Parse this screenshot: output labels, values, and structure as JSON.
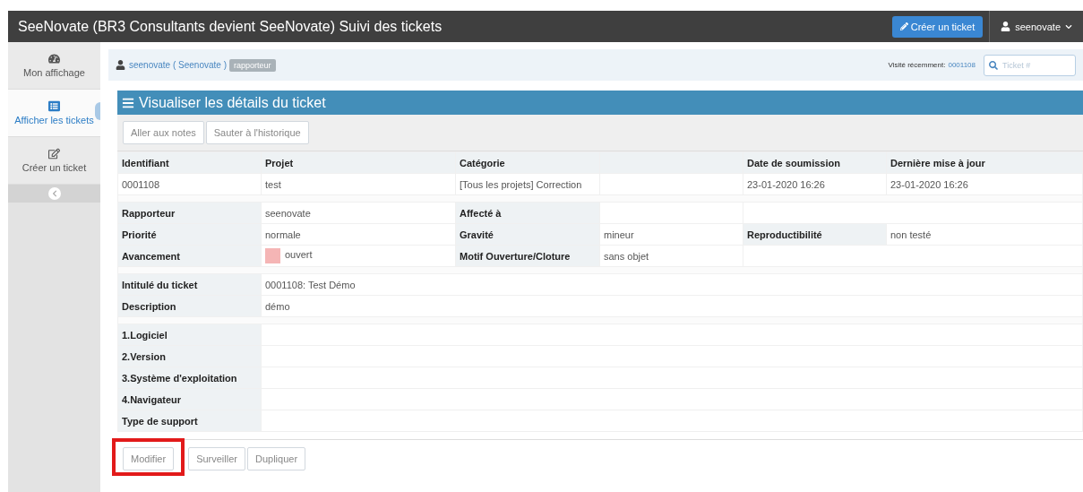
{
  "navbar": {
    "title": "SeeNovate (BR3 Consultants devient SeeNovate) Suivi des tickets",
    "create_button": "Créer un ticket",
    "user_menu": "seenovate"
  },
  "sidebar": {
    "items": [
      {
        "label": "Mon affichage",
        "selected": false
      },
      {
        "label": "Afficher les tickets",
        "selected": true
      },
      {
        "label": "Créer un ticket",
        "selected": false
      }
    ]
  },
  "breadcrumb": {
    "user": "seenovate ( Seenovate )",
    "role": "rapporteur",
    "recent_label": "Visité récemment:",
    "recent_link": "0001108",
    "search": {
      "placeholder": "Ticket #"
    }
  },
  "panel": {
    "title": "Visualiser les détails du ticket",
    "top_buttons": [
      "Aller aux notes",
      "Sauter à l'historique"
    ],
    "summary": [
      {
        "heading": "Identifiant",
        "value": "0001108"
      },
      {
        "heading": "Projet",
        "value": "test"
      },
      {
        "heading": "Catégorie",
        "value": "[Tous les projets] Correction"
      },
      {
        "heading": "Date de soumission",
        "value": "23-01-2020 16:26"
      },
      {
        "heading": "Dernière mise à jour",
        "value": "23-01-2020 16:26"
      }
    ],
    "sections": [
      [
        [
          {
            "label": "Rapporteur",
            "value": "seenovate"
          },
          {
            "label": "Affecté à"
          }
        ],
        [
          {
            "label": "Priorité",
            "value": "normale"
          },
          {
            "label": "Gravité",
            "value": "mineur"
          },
          {
            "label": "Reproductibilité",
            "value": "non testé"
          }
        ],
        [
          {
            "label": "Avancement",
            "value": "ouvert",
            "color": "#f5b5b5"
          },
          {
            "label": "Motif Ouverture/Cloture",
            "value": "sans objet"
          }
        ]
      ],
      [
        [
          {
            "label": "Intitulé du ticket",
            "value": "0001108: Test Démo"
          }
        ],
        [
          {
            "label": "Description",
            "value": "démo"
          }
        ]
      ],
      [
        [
          {
            "label": "1.Logiciel"
          }
        ],
        [
          {
            "label": "2.Version"
          }
        ],
        [
          {
            "label": "3.Système d'exploitation"
          }
        ],
        [
          {
            "label": "4.Navigateur"
          }
        ],
        [
          {
            "label": "Type de support"
          }
        ]
      ]
    ],
    "bottom_buttons": [
      {
        "label": "Modifier",
        "highlighted": true
      },
      {
        "label": "Surveiller",
        "highlighted": false
      },
      {
        "label": "Dupliquer",
        "highlighted": false
      }
    ]
  }
}
